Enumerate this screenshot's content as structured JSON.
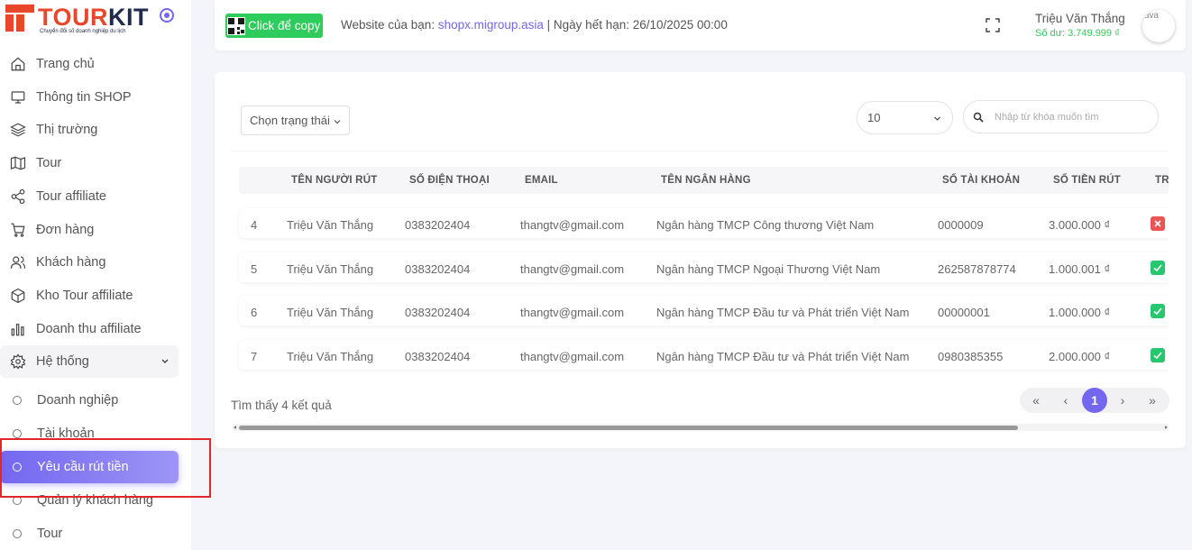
{
  "brand": {
    "name_part1": "TOUR",
    "name_part2": "KIT",
    "tagline": "Chuyển đổi số doanh nghiệp du lịch"
  },
  "sidebar": {
    "items": [
      {
        "label": "Trang chủ",
        "icon": "home-icon"
      },
      {
        "label": "Thông tin SHOP",
        "icon": "monitor-icon"
      },
      {
        "label": "Thị trường",
        "icon": "layers-icon"
      },
      {
        "label": "Tour",
        "icon": "map-icon"
      },
      {
        "label": "Tour affiliate",
        "icon": "share-icon"
      },
      {
        "label": "Đơn hàng",
        "icon": "cart-icon"
      },
      {
        "label": "Khách hàng",
        "icon": "users-icon"
      },
      {
        "label": "Kho Tour affiliate",
        "icon": "box-icon"
      },
      {
        "label": "Doanh thu affiliate",
        "icon": "bar-chart-icon"
      }
    ],
    "group": {
      "label": "Hệ thống",
      "icon": "gear-icon"
    },
    "sub_items": [
      {
        "label": "Doanh nghiệp"
      },
      {
        "label": "Tài khoản"
      },
      {
        "label": "Yêu cầu rút tiền",
        "active": true
      },
      {
        "label": "Quản lý khách hàng"
      },
      {
        "label": "Tour"
      }
    ]
  },
  "topbar": {
    "copy_label": "Click để copy",
    "site_prefix": "Website của bạn: ",
    "site_link": "shopx.migroup.asia",
    "expiry": " | Ngày hết hạn: 26/10/2025 00:00",
    "user_name": "Triệu Văn Thắng",
    "balance": "Số dư: 3.749.999 ₫",
    "avatar_alt": "ava"
  },
  "filters": {
    "status_placeholder": "Chọn trạng thái",
    "page_size": "10",
    "search_placeholder": "Nhập từ khóa muốn tìm"
  },
  "table": {
    "headers": [
      "TÊN NGƯỜI RÚT",
      "SỐ ĐIỆN THOẠI",
      "EMAIL",
      "TÊN NGÂN HÀNG",
      "SỐ TÀI KHOẢN",
      "SỐ TIỀN RÚT",
      "TR"
    ],
    "rows": [
      {
        "no": "4",
        "name": "Triệu Văn Thắng",
        "phone": "0383202404",
        "email": "thangtv@gmail.com",
        "bank": "Ngân hàng TMCP Công thương Việt Nam",
        "account": "0000009",
        "amount": "3.000.000 ₫",
        "status": "rejected"
      },
      {
        "no": "5",
        "name": "Triệu Văn Thắng",
        "phone": "0383202404",
        "email": "thangtv@gmail.com",
        "bank": "Ngân hàng TMCP Ngoại Thương Việt Nam",
        "account": "262587878774",
        "amount": "1.000.001 ₫",
        "status": "approved"
      },
      {
        "no": "6",
        "name": "Triệu Văn Thắng",
        "phone": "0383202404",
        "email": "thangtv@gmail.com",
        "bank": "Ngân hàng TMCP Đầu tư và Phát triển Việt Nam",
        "account": "00000001",
        "amount": "1.000.000 ₫",
        "status": "approved"
      },
      {
        "no": "7",
        "name": "Triệu Văn Thắng",
        "phone": "0383202404",
        "email": "thangtv@gmail.com",
        "bank": "Ngân hàng TMCP Đầu tư và Phát triển Việt Nam",
        "account": "0980385355",
        "amount": "2.000.000 ₫",
        "status": "approved"
      }
    ]
  },
  "footer": {
    "result_text": "Tìm thấy 4 kết quả",
    "pagination": {
      "first": "«",
      "prev": "‹",
      "current": "1",
      "next": "›",
      "last": "»"
    }
  },
  "colors": {
    "accent": "#7367f0",
    "success": "#28c76f",
    "danger": "#ea5455",
    "brand_red": "#e8472c",
    "brand_navy": "#1f2a4c"
  }
}
